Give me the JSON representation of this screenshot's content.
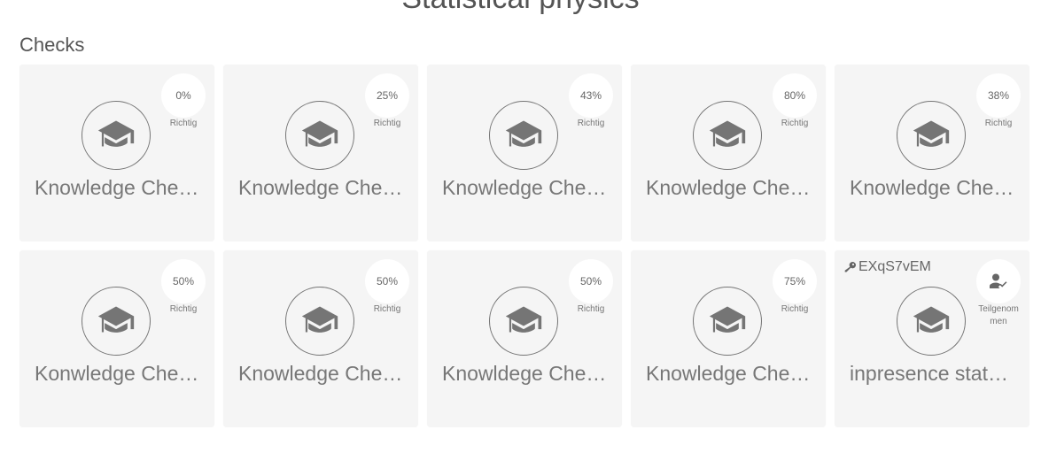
{
  "course": {
    "title": "Statistical physics"
  },
  "section": {
    "title": "Checks"
  },
  "cards": [
    {
      "name": "Knowledge Che…",
      "percent": "0%",
      "status": "Richtig",
      "icon": "graduation-cap-icon"
    },
    {
      "name": "Knowledge Che…",
      "percent": "25%",
      "status": "Richtig",
      "icon": "graduation-cap-icon"
    },
    {
      "name": "Knowledge Che…",
      "percent": "43%",
      "status": "Richtig",
      "icon": "graduation-cap-icon"
    },
    {
      "name": "Knowledge Che…",
      "percent": "80%",
      "status": "Richtig",
      "icon": "graduation-cap-icon"
    },
    {
      "name": "Knowledge Che…",
      "percent": "38%",
      "status": "Richtig",
      "icon": "graduation-cap-icon"
    },
    {
      "name": "Konwledge Che…",
      "percent": "50%",
      "status": "Richtig",
      "icon": "graduation-cap-icon"
    },
    {
      "name": "Knowledge Che…",
      "percent": "50%",
      "status": "Richtig",
      "icon": "graduation-cap-icon"
    },
    {
      "name": "Knowldege Che…",
      "percent": "50%",
      "status": "Richtig",
      "icon": "graduation-cap-icon"
    },
    {
      "name": "Knowledge Che…",
      "percent": "75%",
      "status": "Richtig",
      "icon": "graduation-cap-icon"
    }
  ],
  "shared_card": {
    "name": "inpresence stat…",
    "code": "EXqS7vEM",
    "code_icon": "key-icon",
    "status_icon": "person-check-icon",
    "status": "Teilgenom men",
    "icon": "graduation-cap-icon"
  },
  "colors": {
    "card_background": "#f5f5f5",
    "icon_gray": "#757575",
    "text_gray": "#777777"
  }
}
